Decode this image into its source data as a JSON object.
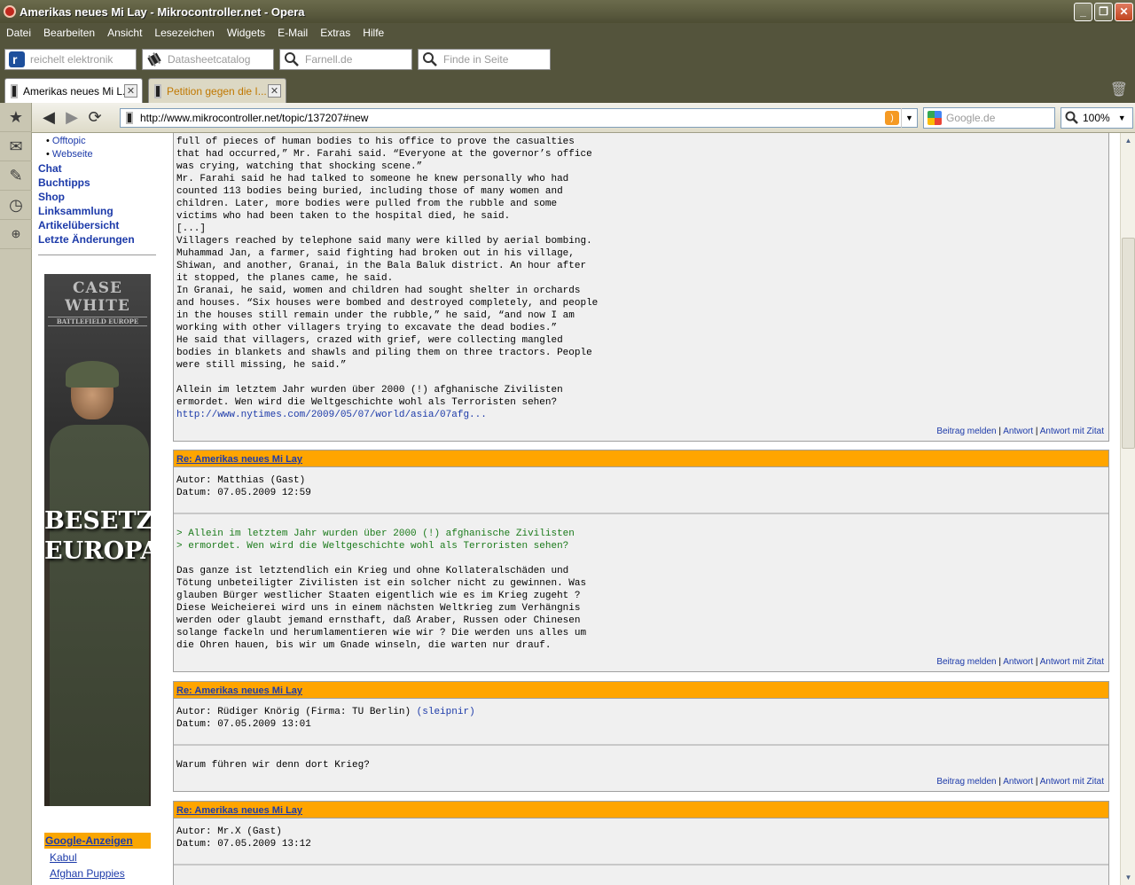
{
  "window": {
    "title": "Amerikas neues Mi Lay - Mikrocontroller.net - Opera",
    "minimize": "_",
    "maximize": "❐",
    "close": "✕"
  },
  "menu": [
    "Datei",
    "Bearbeiten",
    "Ansicht",
    "Lesezeichen",
    "Widgets",
    "E-Mail",
    "Extras",
    "Hilfe"
  ],
  "search_boxes": [
    {
      "placeholder": "reichelt elektronik",
      "icon": "reichelt-logo-icon"
    },
    {
      "placeholder": "Datasheetcatalog",
      "icon": "chip-icon"
    },
    {
      "placeholder": "Farnell.de",
      "icon": "search-icon"
    },
    {
      "placeholder": "Finde in Seite",
      "icon": "search-icon"
    }
  ],
  "tabs": [
    {
      "label": "Amerikas neues Mi L...",
      "active": true
    },
    {
      "label": "Petition gegen die I...",
      "active": false
    }
  ],
  "tab_close": "✕",
  "nav": {
    "url": "http://www.mikrocontroller.net/topic/137207#new",
    "google_placeholder": "Google.de",
    "zoom": "100%",
    "rss": ")"
  },
  "sidebar": {
    "sub_links": [
      "Offtopic",
      "Webseite"
    ],
    "links": [
      "Chat",
      "Buchtipps",
      "Shop",
      "Linksammlung",
      "Artikelübersicht",
      "Letzte Änderungen"
    ],
    "banner": {
      "logo_line1": "CASE WHITE",
      "logo_line2": "BATTLEFIELD EUROPE",
      "slogan1": "BESETZE",
      "slogan2": "EUROPA!"
    },
    "ads_title": "Google-Anzeigen",
    "ads": [
      "Kabul",
      "Afghan Puppies"
    ]
  },
  "actions": {
    "report": "Beitrag melden",
    "sep": "|",
    "reply": "Antwort",
    "reply_quote": "Antwort mit Zitat"
  },
  "posts": {
    "p0": {
      "lines": [
        "full of pieces of human bodies to his office to prove the casualties",
        "that had occurred,” Mr. Farahi said. “Everyone at the governor’s office",
        "was crying, watching that shocking scene.”",
        "Mr. Farahi said he had talked to someone he knew personally who had",
        "counted 113 bodies being buried, including those of many women and",
        "children. Later, more bodies were pulled from the rubble and some",
        "victims who had been taken to the hospital died, he said.",
        "[...]",
        "Villagers reached by telephone said many were killed by aerial bombing.",
        "Muhammad Jan, a farmer, said fighting had broken out in his village,",
        "Shiwan, and another, Granai, in the Bala Baluk district. An hour after",
        "it stopped, the planes came, he said.",
        "In Granai, he said, women and children had sought shelter in orchards",
        "and houses. “Six houses were bombed and destroyed completely, and people",
        "in the houses still remain under the rubble,” he said, “and now I am",
        "working with other villagers trying to excavate the dead bodies.”",
        "He said that villagers, crazed with grief, were collecting mangled",
        "bodies in blankets and shawls and piling them on three tractors. People",
        "were still missing, he said.”",
        "",
        "Allein im letztem Jahr wurden über 2000 (!) afghanische Zivilisten",
        "ermordet. Wen wird die Weltgeschichte wohl als Terroristen sehen?"
      ],
      "link": "http://www.nytimes.com/2009/05/07/world/asia/07afg..."
    },
    "p1": {
      "title": "Re: Amerikas neues Mi Lay",
      "author": "Autor: Matthias (Gast)",
      "date": "Datum: 07.05.2009 12:59",
      "quote": [
        "> Allein im letztem Jahr wurden über 2000 (!) afghanische Zivilisten",
        "> ermordet. Wen wird die Weltgeschichte wohl als Terroristen sehen?"
      ],
      "lines": [
        "Das ganze ist letztendlich ein Krieg und ohne Kollateralschäden und",
        "Tötung unbeteiligter Zivilisten ist ein solcher nicht zu gewinnen. Was",
        "glauben Bürger westlicher Staaten eigentlich wie es im Krieg zugeht ?",
        "Diese Weicheierei wird uns in einem nächsten Weltkrieg zum Verhängnis",
        "werden oder glaubt jemand ernsthaft, daß Araber, Russen oder Chinesen",
        "solange fackeln und herumlamentieren wie wir ? Die werden uns alles um",
        "die Ohren hauen, bis wir um Gnade winseln, die warten nur drauf."
      ]
    },
    "p2": {
      "title": "Re: Amerikas neues Mi Lay",
      "author": "Autor: Rüdiger Knörig (Firma: TU Berlin)",
      "author_nick": "(sleipnir)",
      "date": "Datum: 07.05.2009 13:01",
      "text": "Warum führen wir denn dort Krieg?"
    },
    "p3": {
      "title": "Re: Amerikas neues Mi Lay",
      "author": "Autor: Mr.X (Gast)",
      "date": "Datum: 07.05.2009 13:12"
    }
  }
}
